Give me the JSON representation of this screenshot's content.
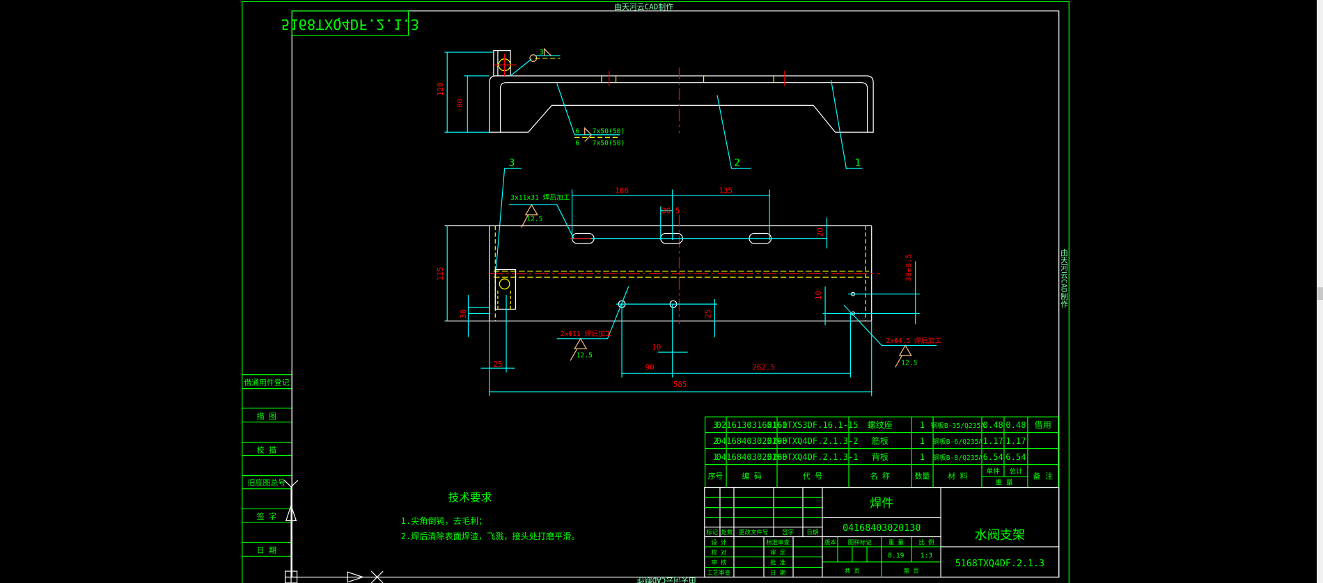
{
  "watermark": "由天河云CAD制作",
  "mirrored_code": "5168TXQ4DF.2.1.3",
  "colors": {
    "frame": "#00ff00",
    "outline": "#ffffff",
    "dimension": "#00ffff",
    "dim_text": "#ff0000",
    "hidden": "#ffff00",
    "weld_symbol": "#ffc080"
  },
  "drawing": {
    "top_view": {
      "dims": {
        "h120": "120",
        "h80": "80"
      },
      "weld_3": "3",
      "weld_6a": "6",
      "weld_len_a": "7x50(50)",
      "weld_6b": "6",
      "weld_len_b": "7x50(50)",
      "balloons": {
        "p1": "1",
        "p2": "2",
        "p3": "3"
      }
    },
    "front_view": {
      "dims": {
        "d166": "166",
        "d135": "135",
        "d30_5": "30.5",
        "d20": "20",
        "d115": "115",
        "d30": "30",
        "d25v": "25",
        "d10v": "10",
        "d30tol": "30±0.5",
        "d10": "10",
        "d25": "25",
        "d90": "90",
        "d262_5": "262.5",
        "d585": "585"
      },
      "note_slots": "3x11x31 焊后加工",
      "note_holes11": "2xΦ11 焊后加工",
      "note_holes45": "2xΦ4.5 焊后加工",
      "roughness": "12.5"
    }
  },
  "tech_requirements": {
    "title": "技术要求",
    "items": [
      "1.尖角倒钝，去毛刺；",
      "2.焊后清除表面焊渣，飞溅，接头处打磨平滑。"
    ]
  },
  "left_column": [
    "借通用件登记",
    "描 图",
    "校 描",
    "旧底图总号",
    "签 字",
    "日 期"
  ],
  "parts_table": {
    "rows": [
      [
        "3",
        "02161303160160",
        "5161TXS3DF.16.1-15",
        "螺纹座",
        "1",
        "钢板B-35/Q235A",
        "0.48",
        "0.48",
        "借用"
      ],
      [
        "2",
        "04168403020290",
        "5168TXQ4DF.2.1.3-2",
        "筋板",
        "1",
        "钢板B-6/Q235A",
        "1.17",
        "1.17",
        ""
      ],
      [
        "1",
        "04168403020280",
        "5168TXQ4DF.2.1.3-1",
        "背板",
        "1",
        "钢板B-8/Q235A",
        "6.54",
        "6.54",
        ""
      ]
    ],
    "headers": {
      "no": "序号",
      "code": "编 码",
      "drawing_no": "代 号",
      "name": "名 称",
      "qty": "数量",
      "material": "材 料",
      "unit": "单件",
      "total": "总计",
      "weight": "重 量",
      "remark": "备 注"
    }
  },
  "title_block": {
    "rev_headers": [
      "标记",
      "处数",
      "更改文件号",
      "签字",
      "日期"
    ],
    "sign_labels": [
      "设 计",
      "标准审查",
      "校 对",
      "审 定",
      "审 核",
      "批 准",
      "工艺审查",
      "日 期"
    ],
    "part_type": "焊件",
    "part_code": "04168403020130",
    "info_headers": {
      "version": "版本",
      "mark": "图样标记",
      "weight": "重 量",
      "scale": "比 例"
    },
    "weight": "8.19",
    "scale": "1:3",
    "sheets_total": "共 页",
    "sheet_no": "第 页",
    "name": "水阀支架",
    "drawing_no": "5168TXQ4DF.2.1.3"
  }
}
